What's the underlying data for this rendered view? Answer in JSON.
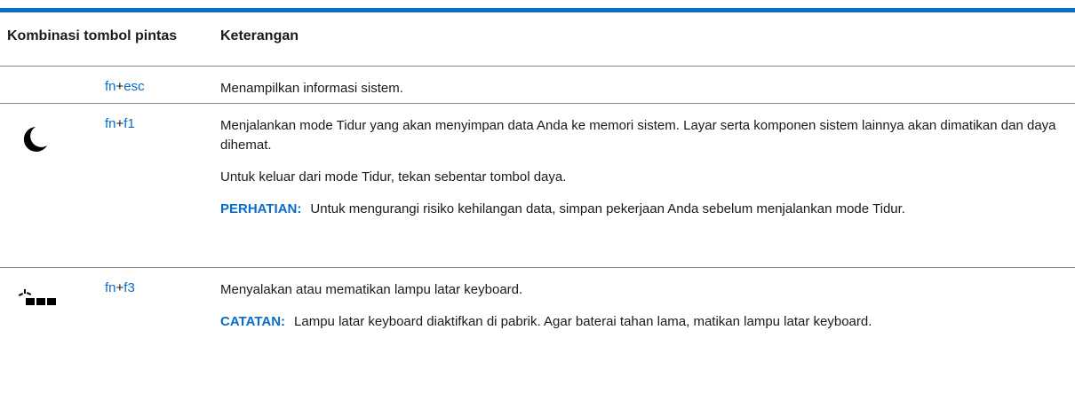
{
  "table": {
    "headers": {
      "combo": "Kombinasi tombol pintas",
      "description": "Keterangan"
    },
    "rows": [
      {
        "icon": "",
        "key_fn": "fn",
        "plus": "+",
        "key_second": "esc",
        "paragraphs": [
          "Menampilkan informasi sistem."
        ]
      },
      {
        "icon": "moon-icon",
        "key_fn": "fn",
        "plus": "+",
        "key_second": "f1",
        "paragraphs": [
          "Menjalankan mode Tidur yang akan menyimpan data Anda ke memori sistem. Layar serta komponen sistem lainnya akan dimatikan dan daya dihemat.",
          "Untuk keluar dari mode Tidur, tekan sebentar tombol daya."
        ],
        "note_label": "PERHATIAN:",
        "note_text": "Untuk mengurangi risiko kehilangan data, simpan pekerjaan Anda sebelum menjalankan mode Tidur."
      },
      {
        "icon": "keyboard-backlight-icon",
        "key_fn": "fn",
        "plus": "+",
        "key_second": "f3",
        "paragraphs": [
          "Menyalakan atau mematikan lampu latar keyboard."
        ],
        "note_label": "CATATAN:",
        "note_text": "Lampu latar keyboard diaktifkan di pabrik. Agar baterai tahan lama, matikan lampu latar keyboard."
      }
    ]
  },
  "colors": {
    "accent": "#0a6cc9",
    "rule": "#8a8a8a",
    "text": "#1a1a1a"
  }
}
